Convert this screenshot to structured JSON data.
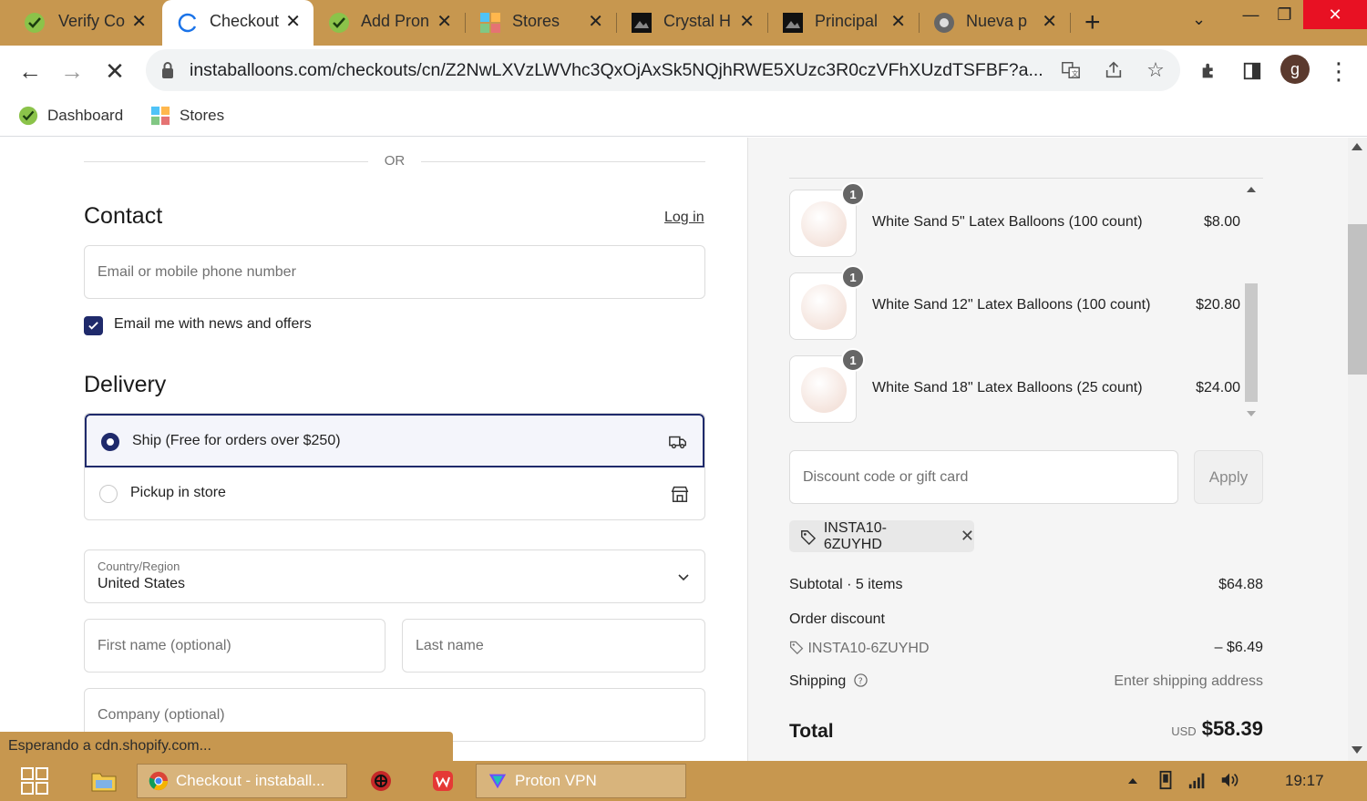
{
  "browser": {
    "tabs": [
      {
        "title": "Verify Co",
        "icon": "check-badge-icon",
        "active": false
      },
      {
        "title": "Checkout",
        "icon": "loading-icon",
        "active": true
      },
      {
        "title": "Add Pron",
        "icon": "check-badge-icon",
        "active": false
      },
      {
        "title": "Stores",
        "icon": "stores-icon",
        "active": false
      },
      {
        "title": "Crystal H",
        "icon": "crystal-icon",
        "active": false
      },
      {
        "title": "Principal",
        "icon": "principal-icon",
        "active": false
      },
      {
        "title": "Nueva p",
        "icon": "chrome-icon",
        "active": false
      }
    ],
    "url": "instaballoons.com/checkouts/cn/Z2NwLXVzLWVhc3QxOjAxSk5NQjhRWE5XUzc3R0czVFhXUzdTSFBF?a...",
    "avatar_letter": "g",
    "bookmarks": [
      {
        "label": "Dashboard",
        "icon": "check-badge-icon"
      },
      {
        "label": "Stores",
        "icon": "stores-icon"
      }
    ],
    "status_text": "Esperando a cdn.shopify.com..."
  },
  "checkout": {
    "or_label": "OR",
    "contact": {
      "heading": "Contact",
      "login_link": "Log in",
      "email_placeholder": "Email or mobile phone number",
      "news_opt_in_label": "Email me with news and offers",
      "news_opt_in_checked": true
    },
    "delivery": {
      "heading": "Delivery",
      "options": [
        {
          "label": "Ship (Free for orders over $250)",
          "selected": true,
          "icon": "truck-icon"
        },
        {
          "label": "Pickup in store",
          "selected": false,
          "icon": "store-icon"
        }
      ],
      "country_label": "Country/Region",
      "country_value": "United States",
      "first_name_placeholder": "First name (optional)",
      "last_name_placeholder": "Last name",
      "company_placeholder": "Company (optional)"
    }
  },
  "summary": {
    "items": [
      {
        "qty": "1",
        "name": "White Sand 5\" Latex Balloons (100 count)",
        "price": "$8.00"
      },
      {
        "qty": "1",
        "name": "White Sand 12\" Latex Balloons (100 count)",
        "price": "$20.80"
      },
      {
        "qty": "1",
        "name": "White Sand 18\" Latex Balloons (25 count)",
        "price": "$24.00"
      }
    ],
    "discount_placeholder": "Discount code or gift card",
    "apply_label": "Apply",
    "applied_code": "INSTA10-6ZUYHD",
    "subtotal_label": "Subtotal · 5 items",
    "subtotal_value": "$64.88",
    "order_discount_label": "Order discount",
    "order_discount_code": "INSTA10-6ZUYHD",
    "order_discount_value": "– $6.49",
    "shipping_label": "Shipping",
    "shipping_value": "Enter shipping address",
    "total_label": "Total",
    "total_currency": "USD",
    "total_value": "$58.39"
  },
  "taskbar": {
    "chrome_window": "Checkout - instaball...",
    "vpn_window": "Proton VPN",
    "time": "19:17"
  },
  "colors": {
    "chrome_frame": "#c7974f",
    "accent": "#1f2a6b"
  }
}
